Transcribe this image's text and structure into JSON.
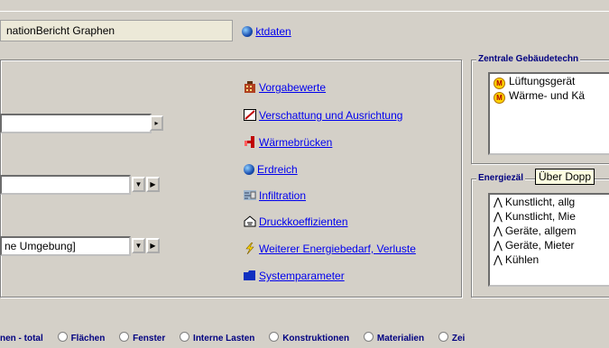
{
  "header": {
    "title_field_text": "nationBericht Graphen",
    "projektdaten_link": "ktdaten"
  },
  "left": {
    "combo1_value": "",
    "combo2_value": "",
    "combo3_value": "ne Umgebung]"
  },
  "links": [
    {
      "label": "Vorgabewerte",
      "icon": "building-icon"
    },
    {
      "label": "Verschattung und Ausrichtung",
      "icon": "shading-icon"
    },
    {
      "label": "Wärmebrücken",
      "icon": "thermal-bridge-icon"
    },
    {
      "label": "Erdreich",
      "icon": "globe-icon"
    },
    {
      "label": "Infiltration",
      "icon": "infiltration-icon"
    },
    {
      "label": "Druckkoeffizienten",
      "icon": "pressure-icon"
    },
    {
      "label": "Weiterer Energiebedarf, Verluste",
      "icon": "lightning-icon"
    },
    {
      "label": "Systemparameter",
      "icon": "folder-icon"
    }
  ],
  "zentrale": {
    "title": "Zentrale Gebäudetechn",
    "items": [
      "Lüftungsgerät",
      "Wärme- und Kä"
    ]
  },
  "energie": {
    "title": "Energiezäl",
    "tooltip": "Über Dopp",
    "items": [
      "Kunstlicht, allg",
      "Kunstlicht, Mie",
      "Geräte, allgem",
      "Geräte, Mieter",
      "Kühlen"
    ]
  },
  "radios": [
    "nen - total",
    "Flächen",
    "Fenster",
    "Interne Lasten",
    "Konstruktionen",
    "Materialien",
    "Zei"
  ],
  "colors": {
    "link": "#0000ee",
    "group_title": "#000080",
    "window_bg": "#d4d0c8"
  }
}
